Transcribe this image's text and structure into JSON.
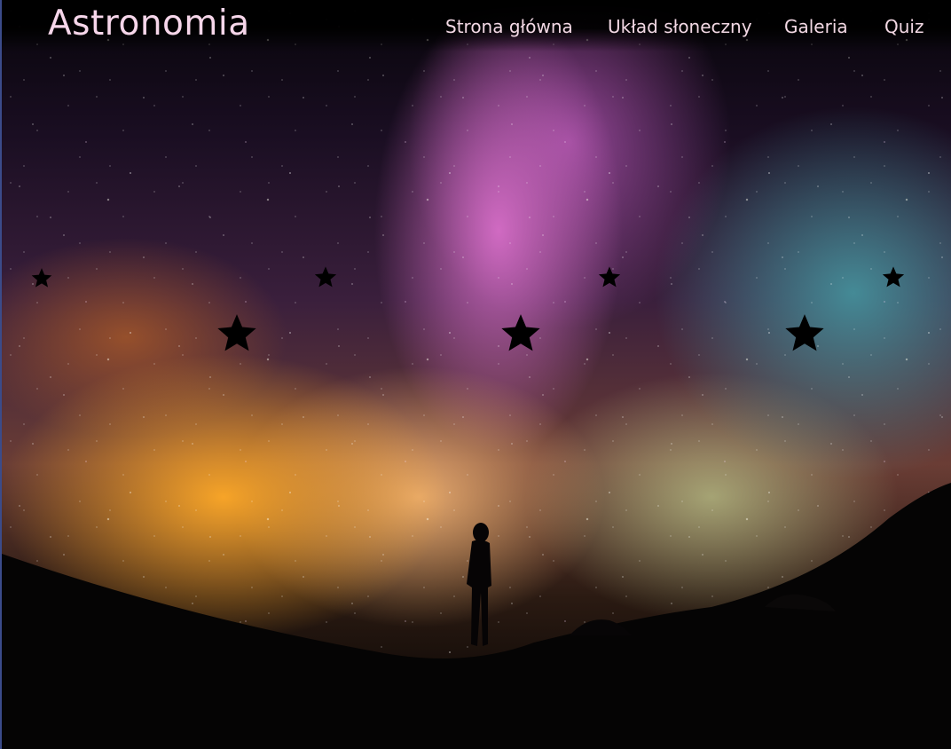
{
  "brand": {
    "title": "Astronomia"
  },
  "nav": {
    "items": [
      {
        "label": "Strona główna"
      },
      {
        "label": "Układ słoneczny"
      },
      {
        "label": "Galeria"
      },
      {
        "label": "Quiz"
      }
    ]
  },
  "hero": {
    "image": "night-sky-milky-way-silhouette",
    "decorations": [
      "star-icon",
      "star-icon",
      "star-icon",
      "star-icon",
      "star-icon",
      "star-icon",
      "star-icon"
    ]
  },
  "colors": {
    "brand_text": "#f6d6ea",
    "nav_text": "#f2d8e4",
    "header_bg": "#000000"
  }
}
